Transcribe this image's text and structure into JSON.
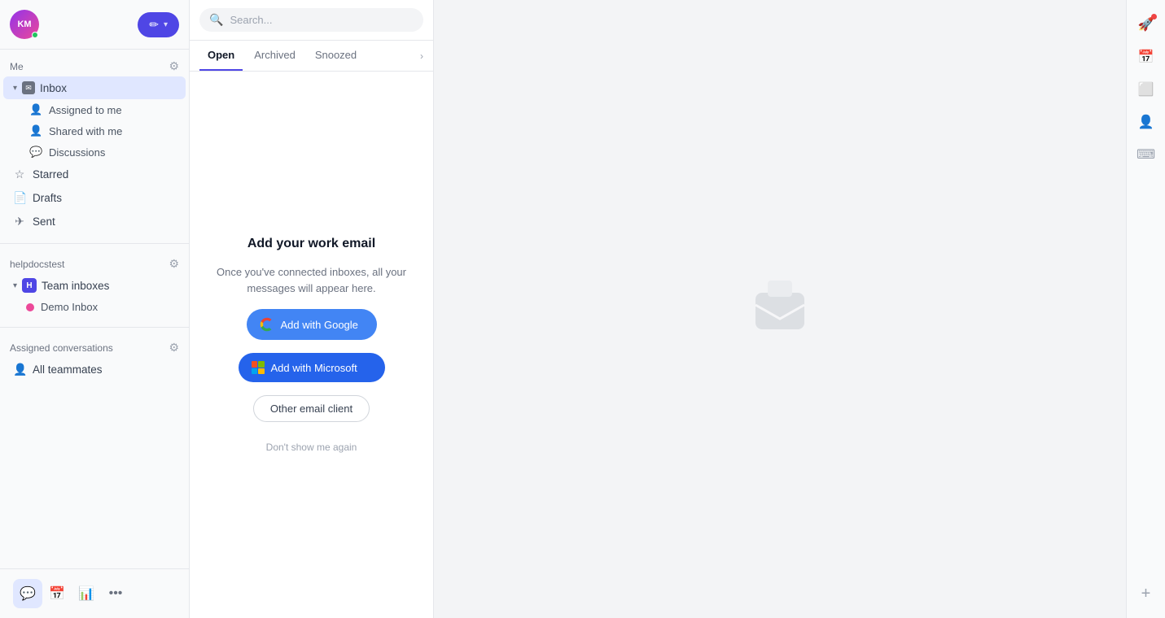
{
  "sidebar": {
    "avatar_initials": "KM",
    "section_me": "Me",
    "gear_label": "settings",
    "inbox_label": "Inbox",
    "sub_items": [
      {
        "id": "assigned-to-me",
        "label": "Assigned to me",
        "icon": "👤"
      },
      {
        "id": "shared-with-me",
        "label": "Shared with me",
        "icon": "👤"
      },
      {
        "id": "discussions",
        "label": "Discussions",
        "icon": "💬"
      }
    ],
    "nav_items": [
      {
        "id": "starred",
        "label": "Starred",
        "icon": "☆"
      },
      {
        "id": "drafts",
        "label": "Drafts",
        "icon": "📄"
      },
      {
        "id": "sent",
        "label": "Sent",
        "icon": "✈"
      }
    ],
    "team_section_label": "helpdocstest",
    "team_inbox_label": "Team inboxes",
    "demo_inbox_label": "Demo Inbox",
    "assigned_section_label": "Assigned conversations",
    "all_teammates_label": "All teammates"
  },
  "compose_button": {
    "label": "✏"
  },
  "search": {
    "placeholder": "Search..."
  },
  "tabs": [
    {
      "id": "open",
      "label": "Open"
    },
    {
      "id": "archived",
      "label": "Archived"
    },
    {
      "id": "snoozed",
      "label": "Snoozed"
    }
  ],
  "add_email": {
    "title": "Add your work email",
    "subtitle": "Once you've connected inboxes, all your messages will appear here.",
    "btn_google": "Add with Google",
    "btn_microsoft": "Add with Microsoft",
    "btn_other": "Other email client",
    "dont_show": "Don't show me again"
  },
  "right_sidebar": {
    "icons": [
      "rocket",
      "calendar",
      "layers",
      "person",
      "keyboard",
      "plus"
    ]
  },
  "bottom_nav": {
    "icons": [
      "chat",
      "calendar",
      "chart",
      "more"
    ]
  }
}
